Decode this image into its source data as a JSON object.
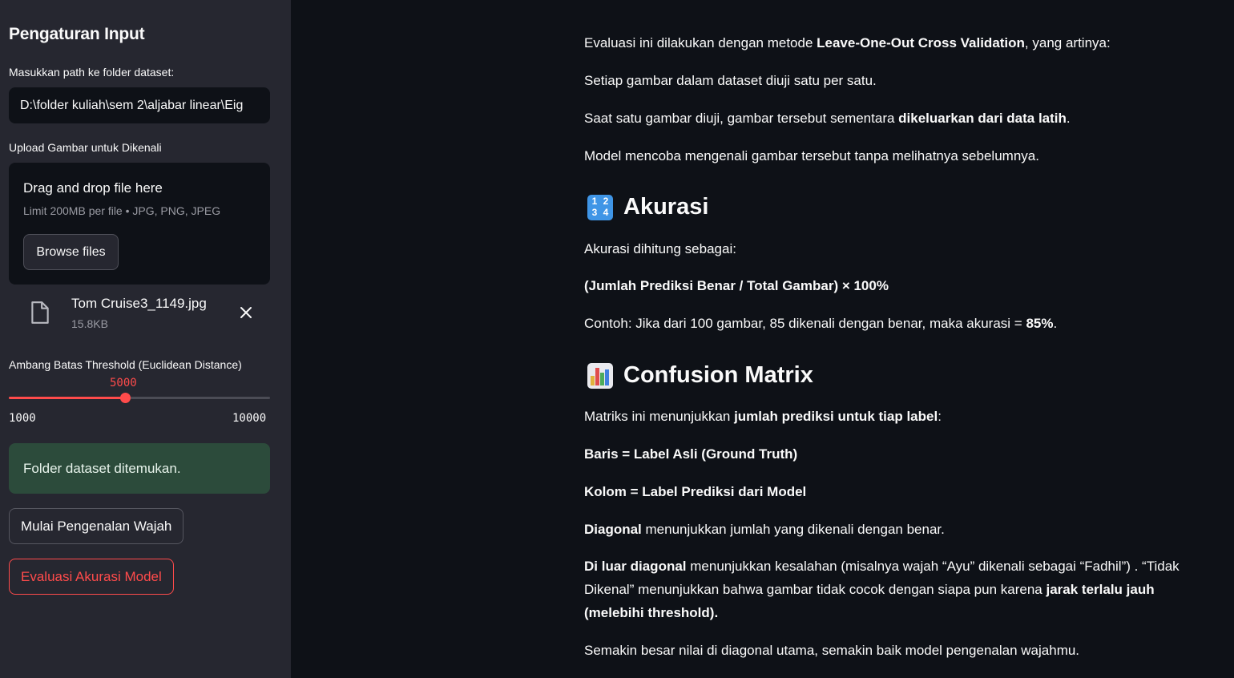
{
  "sidebar": {
    "title": "Pengaturan Input",
    "path_label": "Masukkan path ke folder dataset:",
    "path_value": "D:\\folder kuliah\\sem 2\\aljabar linear\\Eig",
    "upload_label": "Upload Gambar untuk Dikenali",
    "dropzone_title": "Drag and drop file here",
    "dropzone_limit": "Limit 200MB per file • JPG, PNG, JPEG",
    "browse_label": "Browse files",
    "file_name": "Tom Cruise3_1149.jpg",
    "file_size": "15.8KB",
    "threshold_label": "Ambang Batas Threshold (Euclidean Distance)",
    "slider_value": "5000",
    "slider_min": "1000",
    "slider_max": "10000",
    "slider_fraction": 0.444,
    "success_message": "Folder dataset ditemukan.",
    "start_button": "Mulai Pengenalan Wajah",
    "eval_button": "Evaluasi Akurasi Model"
  },
  "main": {
    "intro": {
      "pre": "Evaluasi ini dilakukan dengan metode ",
      "bold": "Leave-One-Out Cross Validation",
      "post": ", yang artinya:"
    },
    "step1": "Setiap gambar dalam dataset diuji satu per satu.",
    "step2": {
      "pre": "Saat satu gambar diuji, gambar tersebut sementara ",
      "bold": "dikeluarkan dari data latih",
      "post": "."
    },
    "step3": "Model mencoba mengenali gambar tersebut tanpa melihatnya sebelumnya.",
    "accuracy_heading": "Akurasi",
    "accuracy_text": "Akurasi dihitung sebagai:",
    "accuracy_formula": "(Jumlah Prediksi Benar / Total Gambar) × 100%",
    "accuracy_example": {
      "pre": "Contoh: Jika dari 100 gambar, 85 dikenali dengan benar, maka akurasi = ",
      "bold": "85%",
      "post": "."
    },
    "confusion_heading": "Confusion Matrix",
    "confusion_intro": {
      "pre": "Matriks ini menunjukkan ",
      "bold": "jumlah prediksi untuk tiap label",
      "post": ":"
    },
    "rows_text": "Baris = Label Asli (Ground Truth)",
    "cols_text": "Kolom = Label Prediksi dari Model",
    "diagonal": {
      "bold": "Diagonal",
      "post": " menunjukkan jumlah yang dikenali dengan benar."
    },
    "off_diagonal": {
      "bold": "Di luar diagonal",
      "mid": " menunjukkan kesalahan (misalnya wajah “Ayu” dikenali sebagai “Fadhil”) . “Tidak Dikenal” menunjukkan bahwa gambar tidak cocok dengan siapa pun karena ",
      "bold2": "jarak terlalu jauh (melebihi threshold)",
      "post": "."
    },
    "closing": "Semakin besar nilai di diagonal utama, semakin baik model pengenalan wajahmu."
  },
  "colors": {
    "accent": "#ff4b4b",
    "sidebar_bg": "#262730",
    "main_bg": "#0e1117",
    "success_bg": "#2c4b3b"
  }
}
